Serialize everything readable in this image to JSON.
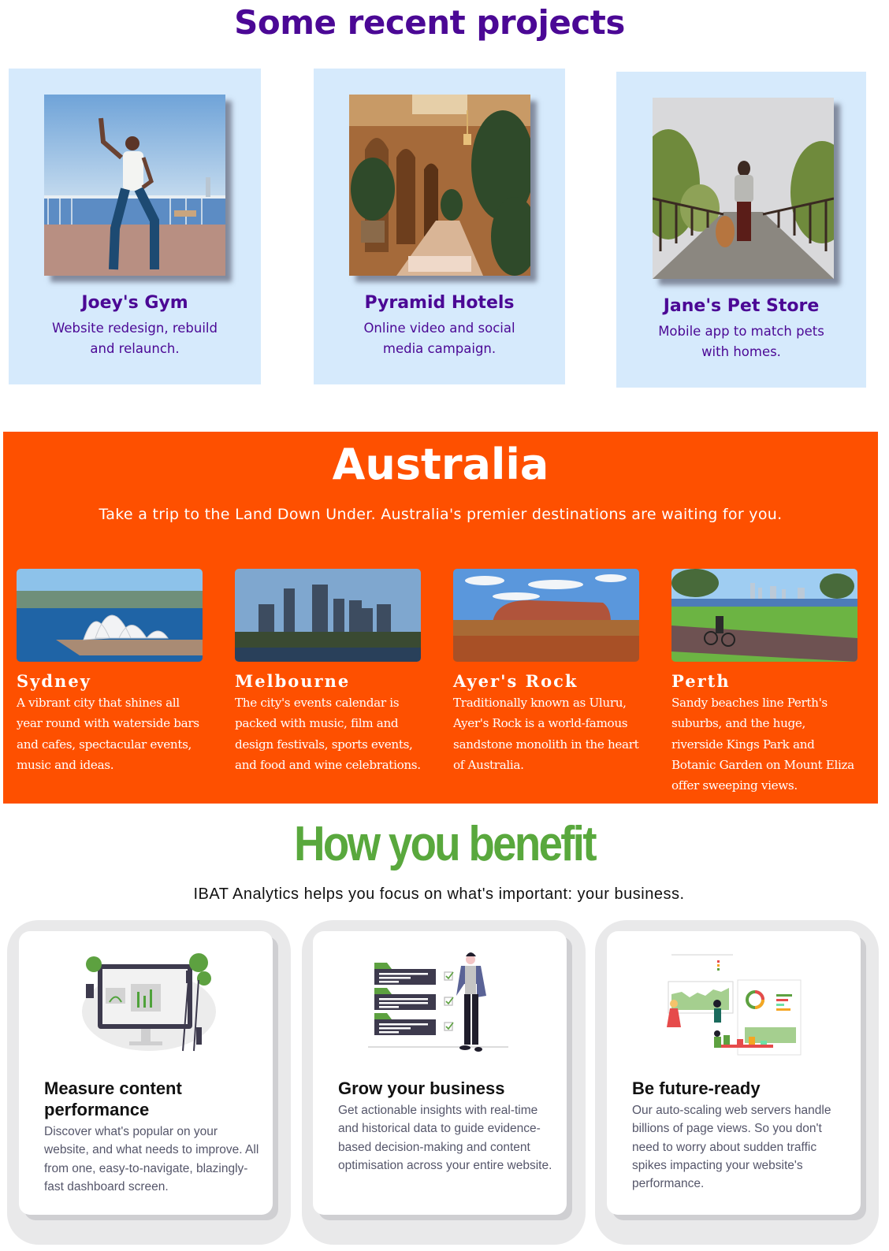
{
  "projects": {
    "title": "Some recent projects",
    "items": [
      {
        "name": "Joey's Gym",
        "description": "Website redesign, rebuild and relaunch.",
        "image": "woman-flexing-on-waterfront-photo"
      },
      {
        "name": "Pyramid Hotels",
        "description": "Online video and social media campaign.",
        "image": "hotel-lobby-with-palms-photo"
      },
      {
        "name": "Jane's Pet Store",
        "description": "Mobile app to match pets with homes.",
        "image": "woman-walking-dog-on-bridge-photo"
      }
    ]
  },
  "australia": {
    "title": "Australia",
    "subtitle": "Take a trip to the Land Down Under. Australia's premier destinations are waiting for you.",
    "destinations": [
      {
        "name": "Sydney",
        "description": "A vibrant city that shines all year round with waterside bars and cafes, spectacular events, music and ideas.",
        "image": "sydney-opera-house-photo"
      },
      {
        "name": "Melbourne",
        "description": "The city's events calendar is packed with music, film and design festivals, sports events, and food and wine celebrations.",
        "image": "melbourne-skyline-photo"
      },
      {
        "name": "Ayer's Rock",
        "description": "Traditionally known as Uluru, Ayer's Rock is a world-famous sandstone monolith in the heart of Australia.",
        "image": "uluru-photo"
      },
      {
        "name": "Perth",
        "description": "Sandy beaches line Perth's suburbs, and the huge, riverside Kings Park and Botanic Garden on Mount Eliza offer sweeping views.",
        "image": "perth-cyclist-park-photo"
      }
    ]
  },
  "benefits": {
    "title": "How you benefit",
    "subtitle": "IBAT Analytics helps you focus on what's important: your business.",
    "items": [
      {
        "title": "Measure content performance",
        "text": "Discover what's popular on your website, and what needs to improve. All from one, easy-to-navigate, blazingly-fast dashboard screen.",
        "illustration": "dashboard-monitor-illustration"
      },
      {
        "title": "Grow your business",
        "text": "Get actionable insights with real-time and historical data to guide evidence-based decision-making and content optimisation across your entire website.",
        "illustration": "checklist-person-illustration"
      },
      {
        "title": "Be future-ready",
        "text": "Our auto-scaling web servers handle billions of page views. So you don't need to worry about sudden traffic spikes impacting your website's performance.",
        "illustration": "analytics-team-illustration"
      }
    ]
  },
  "colors": {
    "projects_accent": "#4b0895",
    "projects_card_bg": "#d6eafc",
    "australia_bg": "#fe5000",
    "benefits_accent": "#59a83d"
  }
}
